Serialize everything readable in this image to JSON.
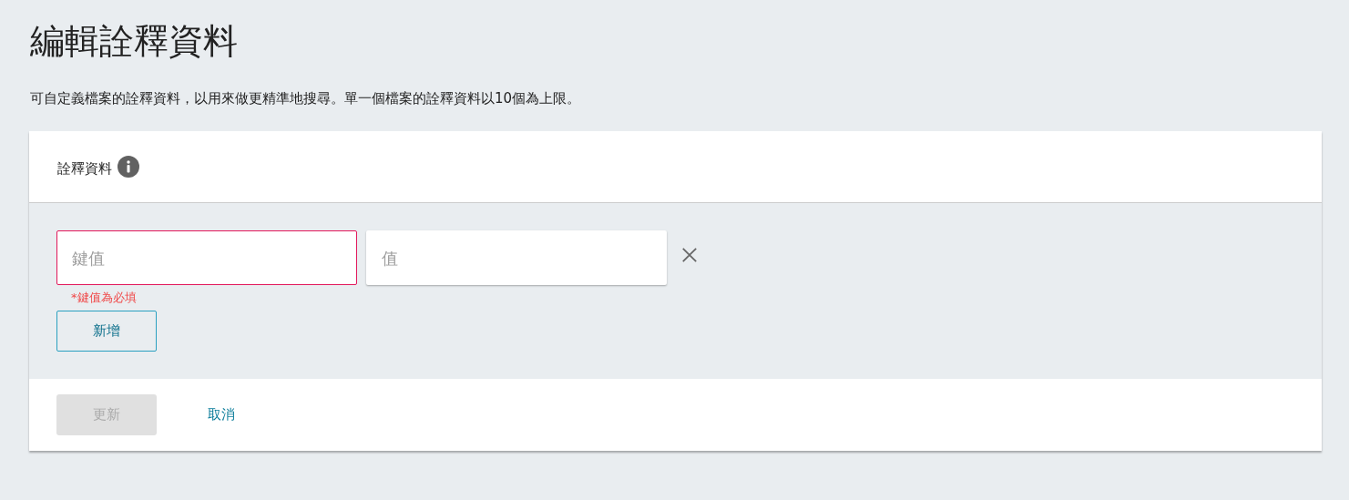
{
  "page": {
    "title": "編輯詮釋資料",
    "description": "可自定義檔案的詮釋資料，以用來做更精準地搜尋。單一個檔案的詮釋資料以10個為上限。"
  },
  "card": {
    "header": "詮釋資料",
    "pairs": [
      {
        "key_placeholder": "鍵值",
        "value_placeholder": "值",
        "invalid": true,
        "error": "*鍵值為必填"
      }
    ],
    "add_button": "新增",
    "update_button": {
      "label": "更新",
      "disabled": true
    },
    "cancel_link": "取消"
  }
}
